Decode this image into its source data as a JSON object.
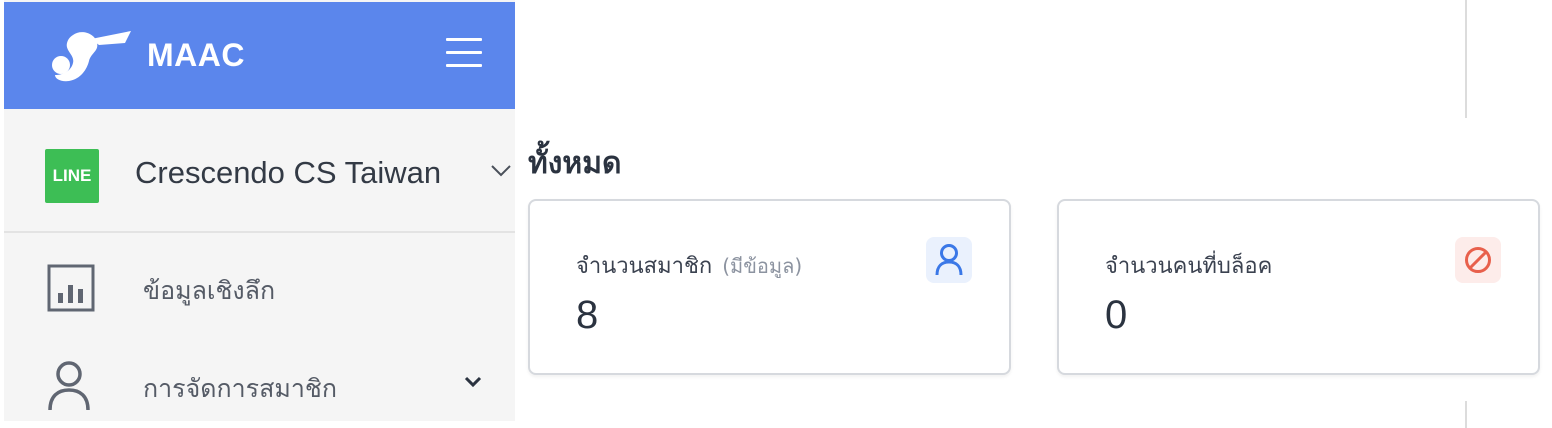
{
  "header": {
    "brand": "MAAC",
    "logo_icon": "maac-bird-logo",
    "menu_icon": "hamburger-icon",
    "color": "#5b86ec"
  },
  "account": {
    "badge": "LINE",
    "badge_color": "#3dbe55",
    "name": "Crescendo CS Taiwan"
  },
  "sidebar": {
    "items": [
      {
        "label": "ข้อมูลเชิงลึก",
        "icon": "bar-chart-icon"
      },
      {
        "label": "การจัดการสมาชิก",
        "icon": "person-icon",
        "expandable": true
      }
    ]
  },
  "main": {
    "section_title": "ทั้งหมด",
    "cards": [
      {
        "label": "จำนวนสมาชิก",
        "sublabel": "(มีข้อมูล)",
        "value": "8",
        "icon": "user-icon",
        "icon_color": "#3b78e7",
        "icon_bg": "#eaf1fd"
      },
      {
        "label": "จำนวนคนที่บล็อค",
        "value": "0",
        "icon": "block-icon",
        "icon_color": "#e8604c",
        "icon_bg": "#fdecea"
      }
    ]
  }
}
